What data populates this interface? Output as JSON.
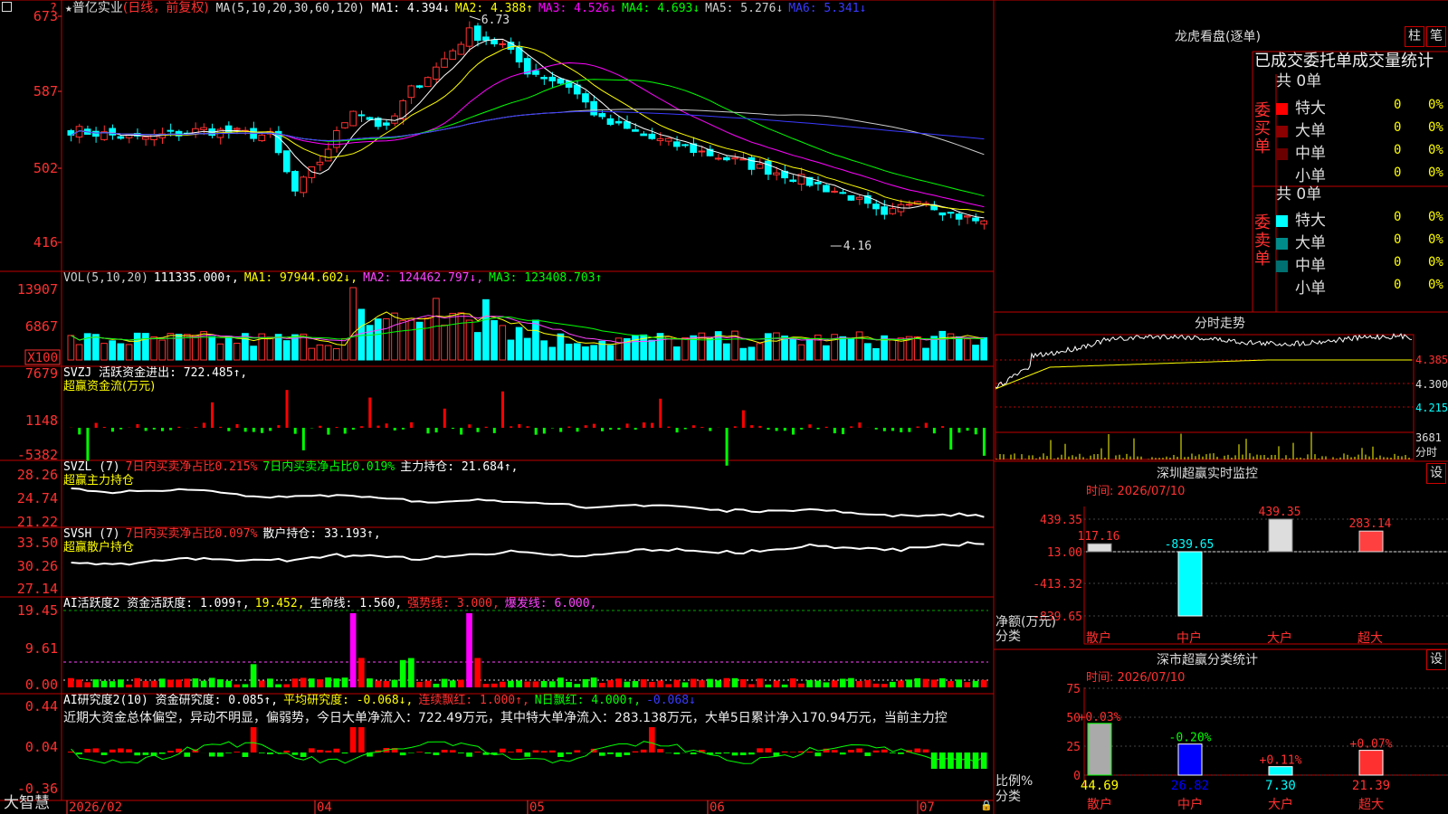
{
  "title_bar": {
    "star": "★",
    "stock_name": "普亿实业",
    "period": "(日线，前复权)",
    "ma_label": "MA(5,10,20,30,60,120)",
    "ma_items": [
      {
        "text": "MA1: 4.394↓",
        "color": "#ffffff"
      },
      {
        "text": "MA2: 4.388↑",
        "color": "#ffff00"
      },
      {
        "text": "MA3: 4.526↓",
        "color": "#ff00ff"
      },
      {
        "text": "MA4: 4.693↓",
        "color": "#00ff00"
      },
      {
        "text": "MA5: 5.276↓",
        "color": "#cccccc"
      },
      {
        "text": "MA6: 5.341↓",
        "color": "#3a3aff"
      }
    ]
  },
  "price_pane": {
    "ticks": [
      "673",
      "587",
      "502",
      "416"
    ],
    "high_label": "6.73",
    "low_label": "4.16"
  },
  "vol_pane": {
    "ticks": [
      "13907",
      "6867",
      "X100"
    ],
    "header": [
      {
        "text": "VOL(5,10,20)",
        "color": "#cccccc"
      },
      {
        "text": "111335.000↑,",
        "color": "#ffffff"
      },
      {
        "text": "MA1: 97944.602↓,",
        "color": "#ffff00"
      },
      {
        "text": "MA2: 124462.797↓,",
        "color": "#ff44ff"
      },
      {
        "text": "MA3: 123408.703↑",
        "color": "#00ff00"
      }
    ]
  },
  "svzj_pane": {
    "ticks": [
      "7679",
      "1148",
      "-5382"
    ],
    "header1": [
      {
        "text": "SVZJ  活跃资金进出: 722.485↑,",
        "color": "#ffffff"
      }
    ],
    "header2": "超赢资金流(万元)"
  },
  "svzl_pane": {
    "ticks": [
      "28.26",
      "24.74",
      "21.22"
    ],
    "header1": [
      {
        "text": "SVZL (7)",
        "color": "#ffffff"
      },
      {
        "text": "7日内买卖净占比0.215%",
        "color": "#ff3030"
      },
      {
        "text": "7日内买卖净占比0.019%",
        "color": "#00ff00"
      },
      {
        "text": "主力持仓: 21.684↑,",
        "color": "#ffffff"
      }
    ],
    "header2": "超赢主力持仓"
  },
  "svsh_pane": {
    "ticks": [
      "33.50",
      "30.26",
      "27.14"
    ],
    "header1": [
      {
        "text": "SVSH (7)",
        "color": "#ffffff"
      },
      {
        "text": "7日内买卖净占比0.097%",
        "color": "#ff3030"
      },
      {
        "text": "散户持仓: 33.193↑,",
        "color": "#ffffff"
      }
    ],
    "header2": "超赢散户持仓"
  },
  "ai_active_pane": {
    "ticks": [
      "19.45",
      "9.61",
      "0.00"
    ],
    "header1": [
      {
        "text": "AI活跃度2 资金活跃度: 1.099↑,",
        "color": "#ffffff"
      },
      {
        "text": "19.452,",
        "color": "#ffff00"
      },
      {
        "text": "生命线: 1.560,",
        "color": "#ffffff"
      },
      {
        "text": "强势线: 3.000,",
        "color": "#ff3030"
      },
      {
        "text": "爆发线: 6.000,",
        "color": "#ff44ff"
      }
    ]
  },
  "ai_research_pane": {
    "ticks": [
      "0.44",
      "0.04",
      "-0.36"
    ],
    "header1": [
      {
        "text": "AI研究度2(10) 资金研究度: 0.085↑,",
        "color": "#ffffff"
      },
      {
        "text": "平均研究度: -0.068↓,",
        "color": "#ffff00"
      },
      {
        "text": "连续飘红: 1.000↑,",
        "color": "#ff3030"
      },
      {
        "text": "N日飘红: 4.000↑,",
        "color": "#00ff00"
      },
      {
        "text": "-0.068↓",
        "color": "#3a3aff"
      }
    ],
    "summary": "近期大资金总体偏空，异动不明显，偏弱势，今日大单净流入：722.49万元，其中特大单净流入：283.138万元，大单5日累计净入170.94万元，当前主力控"
  },
  "x_axis": {
    "labels": [
      "2026/02",
      "04",
      "05",
      "06",
      "07"
    ]
  },
  "status_left": "大智慧",
  "dragon_tiger": {
    "title": "龙虎看盘(逐单)",
    "btn1": "柱",
    "btn2": "笔",
    "header": "已成交委托单成交量统计",
    "buy_label": "委买单",
    "sell_label": "委卖单",
    "buy_total": "共 0单",
    "sell_total": "共 0单",
    "buy_rows": [
      {
        "label": "特大",
        "count": "0",
        "pct": "0%",
        "color": "#ff0000"
      },
      {
        "label": "大单",
        "count": "0",
        "pct": "0%",
        "color": "#8b0000"
      },
      {
        "label": "中单",
        "count": "0",
        "pct": "0%",
        "color": "#6b0000"
      },
      {
        "label": "小单",
        "count": "0",
        "pct": "0%",
        "color": ""
      }
    ],
    "sell_rows": [
      {
        "label": "特大",
        "count": "0",
        "pct": "0%",
        "color": "#00ffff"
      },
      {
        "label": "大单",
        "count": "0",
        "pct": "0%",
        "color": "#008b8b"
      },
      {
        "label": "中单",
        "count": "0",
        "pct": "0%",
        "color": "#007070"
      },
      {
        "label": "小单",
        "count": "0",
        "pct": "0%",
        "color": ""
      }
    ]
  },
  "intraday": {
    "title": "分时走势",
    "price_ticks": [
      "4.385",
      "4.300",
      "4.215"
    ],
    "vol_tick": "3681",
    "corner_label": "分时"
  },
  "sz_monitor": {
    "title": "深圳超赢实时监控",
    "btn": "设",
    "time": "时间: 2026/07/10",
    "y_ticks": [
      "439.35",
      "13.00",
      "-413.32",
      "-839.65"
    ],
    "y_label": "净额(万元)",
    "x_label": "分类",
    "categories": [
      "散户",
      "中户",
      "大户",
      "超大"
    ],
    "values": [
      117.16,
      -839.65,
      439.35,
      283.14
    ],
    "value_labels": [
      "117.16",
      "-839.65",
      "439.35",
      "283.14"
    ]
  },
  "sz_classify": {
    "title": "深市超赢分类统计",
    "btn": "设",
    "time": "时间: 2026/07/10",
    "y_ticks": [
      "75",
      "50",
      "25",
      "0"
    ],
    "y_label": "比例%",
    "x_label": "分类",
    "categories": [
      "散户",
      "中户",
      "大户",
      "超大"
    ],
    "values": [
      44.69,
      26.82,
      7.3,
      21.39
    ],
    "value_labels": [
      "44.69",
      "26.82",
      "7.30",
      "21.39"
    ],
    "changes": [
      "+0.03%",
      "-0.20%",
      "+0.11%",
      "+0.07%"
    ]
  },
  "chart_data": {
    "type": "candlestick",
    "title": "普亿实业",
    "price_range": [
      4.16,
      6.73
    ],
    "high": 6.73,
    "low": 4.16,
    "volume_range": [
      0,
      13907
    ],
    "x_labels": [
      "2026/02",
      "04",
      "05",
      "06",
      "07"
    ],
    "last_close_estimate": 4.4,
    "series_last": {
      "MA1": 4.394,
      "MA2": 4.388,
      "MA3": 4.526,
      "MA4": 4.693,
      "MA5": 5.276,
      "MA6": 5.341
    }
  }
}
